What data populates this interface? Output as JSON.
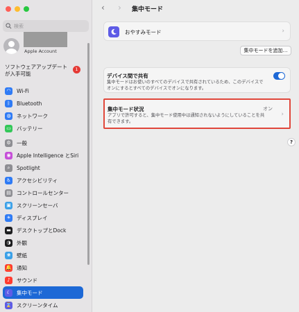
{
  "search": {
    "placeholder": "検索"
  },
  "account": {
    "subtitle": "Apple Account"
  },
  "update": {
    "label": "ソフトウェアアップデートが入手可能",
    "badge": "1"
  },
  "sidebar_groups": [
    [
      {
        "label": "Wi-Fi",
        "icon": "wifi-icon",
        "color": "#2f7bf5",
        "glyph": "◠"
      },
      {
        "label": "Bluetooth",
        "icon": "bluetooth-icon",
        "color": "#2f7bf5",
        "glyph": "ᛒ"
      },
      {
        "label": "ネットワーク",
        "icon": "network-icon",
        "color": "#2f7bf5",
        "glyph": "◍"
      },
      {
        "label": "バッテリー",
        "icon": "battery-icon",
        "color": "#34c759",
        "glyph": "▭"
      }
    ],
    [
      {
        "label": "一般",
        "icon": "gear-icon",
        "color": "#8e8e93",
        "glyph": "⚙"
      },
      {
        "label": "Apple Intelligence とSiri",
        "icon": "siri-icon",
        "color": "#c64fd8",
        "glyph": "◉"
      },
      {
        "label": "Spotlight",
        "icon": "spotlight-icon",
        "color": "#8e8e93",
        "glyph": "⌕"
      },
      {
        "label": "アクセシビリティ",
        "icon": "accessibility-icon",
        "color": "#2f7bf5",
        "glyph": "♿"
      },
      {
        "label": "コントロールセンター",
        "icon": "control-center-icon",
        "color": "#8e8e93",
        "glyph": "▤"
      },
      {
        "label": "スクリーンセーバ",
        "icon": "screensaver-icon",
        "color": "#3aa0e8",
        "glyph": "▣"
      },
      {
        "label": "ディスプレイ",
        "icon": "display-icon",
        "color": "#2f7bf5",
        "glyph": "☀"
      },
      {
        "label": "デスクトップとDock",
        "icon": "dock-icon",
        "color": "#1d1d1f",
        "glyph": "▬"
      },
      {
        "label": "外観",
        "icon": "appearance-icon",
        "color": "#1d1d1f",
        "glyph": "◑"
      },
      {
        "label": "壁紙",
        "icon": "wallpaper-icon",
        "color": "#3aa0e8",
        "glyph": "❀"
      }
    ],
    [
      {
        "label": "通知",
        "icon": "bell-icon",
        "color": "#ff3b30",
        "glyph": "🔔"
      },
      {
        "label": "サウンド",
        "icon": "sound-icon",
        "color": "#ff3b30",
        "glyph": "♪"
      },
      {
        "label": "集中モード",
        "icon": "moon-icon",
        "color": "#5e5ce6",
        "glyph": "☾",
        "selected": true
      },
      {
        "label": "スクリーンタイム",
        "icon": "hourglass-icon",
        "color": "#5e5ce6",
        "glyph": "⌛"
      }
    ]
  ],
  "header": {
    "title": "集中モード"
  },
  "main": {
    "sleep_label": "おやすみモード",
    "add_button": "集中モードを追加…",
    "share": {
      "title": "デバイス間で共有",
      "desc": "集中モードはお使いのすべてのデバイスで共有されているため、このデバイスでオンにするとすべてのデバイスでオンになります。",
      "enabled": true
    },
    "status": {
      "title": "集中モード状況",
      "desc": "アプリで許可すると、集中モード使用中は通知されないようにしていることを共有できます。",
      "value": "オン"
    },
    "help": "?"
  }
}
